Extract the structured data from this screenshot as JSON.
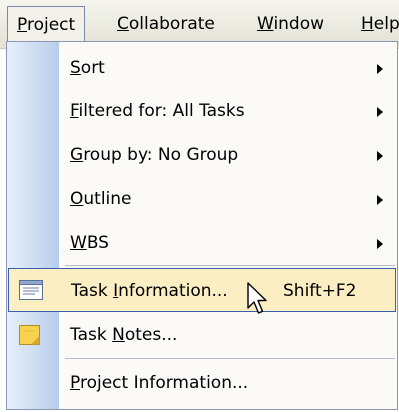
{
  "menubar": {
    "items": [
      {
        "pre": "",
        "ul": "P",
        "post": "roject"
      },
      {
        "pre": "",
        "ul": "C",
        "post": "ollaborate"
      },
      {
        "pre": "",
        "ul": "W",
        "post": "indow"
      },
      {
        "pre": "",
        "ul": "H",
        "post": "elp"
      }
    ]
  },
  "menu": {
    "items": [
      {
        "pre": "",
        "ul": "S",
        "post": "ort",
        "submenu": true
      },
      {
        "pre": "",
        "ul": "F",
        "post": "iltered for: All Tasks",
        "submenu": true
      },
      {
        "pre": "",
        "ul": "G",
        "post": "roup by: No Group",
        "submenu": true
      },
      {
        "pre": "",
        "ul": "O",
        "post": "utline",
        "submenu": true
      },
      {
        "pre": "",
        "ul": "W",
        "post": "BS",
        "submenu": true
      },
      {
        "pre": "Task ",
        "ul": "I",
        "post": "nformation...",
        "shortcut": "Shift+F2",
        "icon": "task-information-icon",
        "highlighted": true
      },
      {
        "pre": "Task ",
        "ul": "N",
        "post": "otes...",
        "icon": "task-notes-icon"
      },
      {
        "pre": "",
        "ul": "P",
        "post": "roject Information..."
      }
    ]
  },
  "colors": {
    "highlight_bg": "#fbeec2",
    "highlight_border": "#3a5fb0",
    "gutter": "#b8cdeb"
  }
}
